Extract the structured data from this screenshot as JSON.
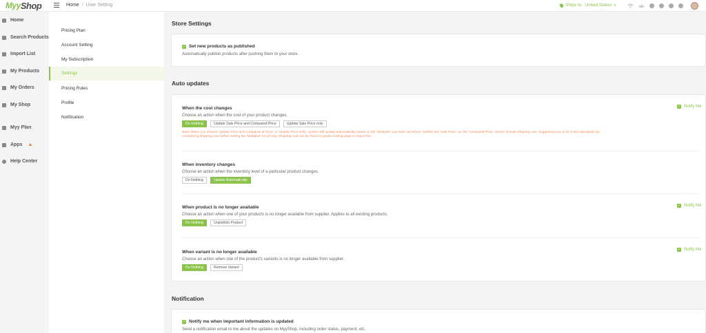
{
  "header": {
    "logo_m": "Myy",
    "logo_s": "Shop",
    "breadcrumb_home": "Home",
    "breadcrumb_sep": "/",
    "breadcrumb_current": "User Setting",
    "ships_label": "Ships to:",
    "ships_value": "United States",
    "ships_caret": "▾"
  },
  "leftnav": {
    "items": [
      {
        "label": "Home"
      },
      {
        "label": "Search Products"
      },
      {
        "label": "Import List"
      },
      {
        "label": "My Products"
      },
      {
        "label": "My Orders"
      },
      {
        "label": "My Shop"
      },
      {
        "label": "Myy Plan"
      },
      {
        "label": "Apps"
      },
      {
        "label": "Help Center"
      }
    ]
  },
  "submenu": {
    "items": [
      {
        "label": "Pricing Plan"
      },
      {
        "label": "Account Setting"
      },
      {
        "label": "My Subscription"
      },
      {
        "label": "Settings"
      },
      {
        "label": "Pricing Rules"
      },
      {
        "label": "Profile"
      },
      {
        "label": "Notification"
      }
    ],
    "active": "Settings"
  },
  "store_settings": {
    "title": "Store Settings",
    "checkbox_label": "Set new products as published",
    "checked": true,
    "description": "Automatically publish products after pushing them to your store."
  },
  "auto_updates": {
    "title": "Auto updates",
    "notify_label": "Notify Me",
    "cost": {
      "title": "When the cost changes",
      "description": "Choose an action when the cost of your product changes.",
      "buttons": [
        "Do Nothing",
        "Update Sale Price and Compared Price",
        "Update Sale Price only"
      ],
      "selected": "Do Nothing",
      "note": "Note: When you choose 'Update Price and Compared at Price' or 'Update Price Only', system will update automatically based on the 'Multiplier' you have set before. Neither the 'Sale Price' nor the 'Compared Price' doesn't include shipping cost. Suggesting you to do a test calculation by considering shipping cost before setting the 'Multiplier' for pricing. Shipping cost can be found in product listing page or import list."
    },
    "inventory": {
      "title": "When inventory changes",
      "description": "Choose an action when the inventory level of a particular product changes.",
      "buttons": [
        "Do Nothing",
        "Update Automatically"
      ],
      "selected": "Update Automatically"
    },
    "unavailable": {
      "title": "When product is no longer available",
      "description": "Choose an action when one of your products is no longer available from supplier. Applies to all existing products.",
      "buttons": [
        "Do Nothing",
        "Unpublish Product"
      ],
      "selected": "Do Nothing"
    },
    "variant": {
      "title": "When variant is no longer available",
      "description": "Choose an action when one of the product's variants is no longer available from supplier.",
      "buttons": [
        "Do Nothing",
        "Remove Variant"
      ],
      "selected": "Do Nothing"
    }
  },
  "notification": {
    "title": "Notification",
    "checkbox_label": "Notify me when important information is updated",
    "checked": true,
    "description": "Send a notification email to me about the updates on MyyShop, including order status, payment, etc."
  },
  "colors": {
    "accent": "#8bc34a",
    "note": "#f08a5d"
  }
}
